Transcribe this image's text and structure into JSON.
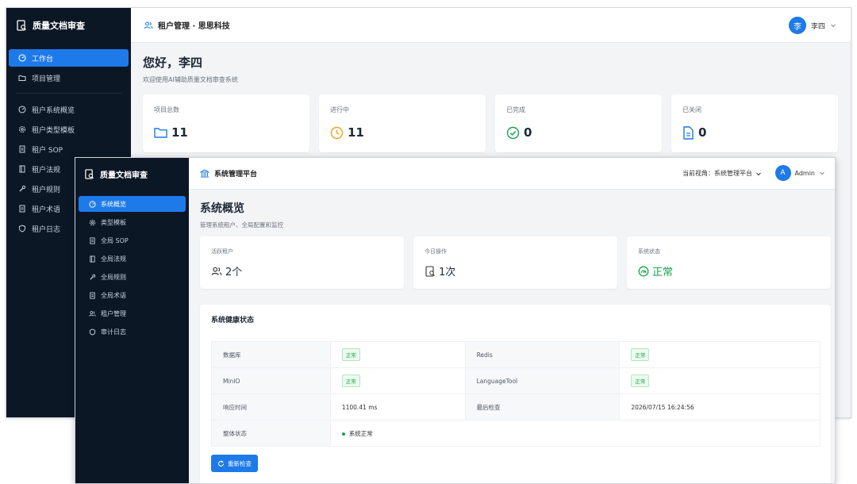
{
  "tenant_window": {
    "brand": "质量文档审查",
    "header_title": "租户管理 · 思思科技",
    "user_name": "李四",
    "avatar_letter": "李",
    "nav": [
      {
        "label": "工作台",
        "icon": "dashboard-icon",
        "active": true
      },
      {
        "label": "项目管理",
        "icon": "folder-icon",
        "active": false
      },
      {
        "label": "租户系统概览",
        "icon": "dashboard-icon",
        "active": false
      },
      {
        "label": "租户类型模板",
        "icon": "gear-icon",
        "active": false
      },
      {
        "label": "租户 SOP",
        "icon": "document-icon",
        "active": false
      },
      {
        "label": "租户法规",
        "icon": "book-icon",
        "active": false
      },
      {
        "label": "租户规则",
        "icon": "wrench-icon",
        "active": false
      },
      {
        "label": "租户术语",
        "icon": "document-icon",
        "active": false
      },
      {
        "label": "租户日志",
        "icon": "shield-icon",
        "active": false
      }
    ],
    "greeting": "您好，李四",
    "subtitle": "欢迎使用AI辅助质量文档审查系统",
    "stats": [
      {
        "label": "项目总数",
        "value": "11",
        "icon": "folder-icon",
        "color": "#1e7ae8"
      },
      {
        "label": "进行中",
        "value": "11",
        "icon": "clock-icon",
        "color": "#f0a020"
      },
      {
        "label": "已完成",
        "value": "0",
        "icon": "check-circle-icon",
        "color": "#16a34a"
      },
      {
        "label": "已关闭",
        "value": "0",
        "icon": "file-icon",
        "color": "#1e7ae8"
      }
    ]
  },
  "admin_window": {
    "brand": "质量文档审查",
    "header_title": "系统管理平台",
    "view_switch": "当前视角：系统管理平台",
    "user_name": "Admin",
    "avatar_letter": "A",
    "nav": [
      {
        "label": "系统概览",
        "icon": "dashboard-icon",
        "active": true
      },
      {
        "label": "类型模板",
        "icon": "gear-icon",
        "active": false
      },
      {
        "label": "全局 SOP",
        "icon": "document-icon",
        "active": false
      },
      {
        "label": "全局法规",
        "icon": "book-icon",
        "active": false
      },
      {
        "label": "全局规则",
        "icon": "wrench-icon",
        "active": false
      },
      {
        "label": "全局术语",
        "icon": "document-icon",
        "active": false
      },
      {
        "label": "租户管理",
        "icon": "users-icon",
        "active": false
      },
      {
        "label": "审计日志",
        "icon": "shield-icon",
        "active": false
      }
    ],
    "page_title": "系统概览",
    "page_subtitle": "管理系统租户、全局配置和监控",
    "stats": [
      {
        "label": "活跃租户",
        "value": "2个",
        "icon": "users-icon"
      },
      {
        "label": "今日操作",
        "value": "1次",
        "icon": "file-search-icon"
      },
      {
        "label": "系统状态",
        "value": "正常",
        "icon": "gauge-icon"
      }
    ],
    "health": {
      "title": "系统健康状态",
      "rows": [
        [
          "数据库",
          "正常",
          "Redis",
          "正常"
        ],
        [
          "MinIO",
          "正常",
          "LanguageTool",
          "正常"
        ],
        [
          "响应时间",
          "1100.41 ms",
          "最后检查",
          "2026/07/15 16:24:56"
        ]
      ],
      "overall_label": "整体状态",
      "overall_value": "系统正常",
      "recheck_label": "重新检查"
    }
  }
}
